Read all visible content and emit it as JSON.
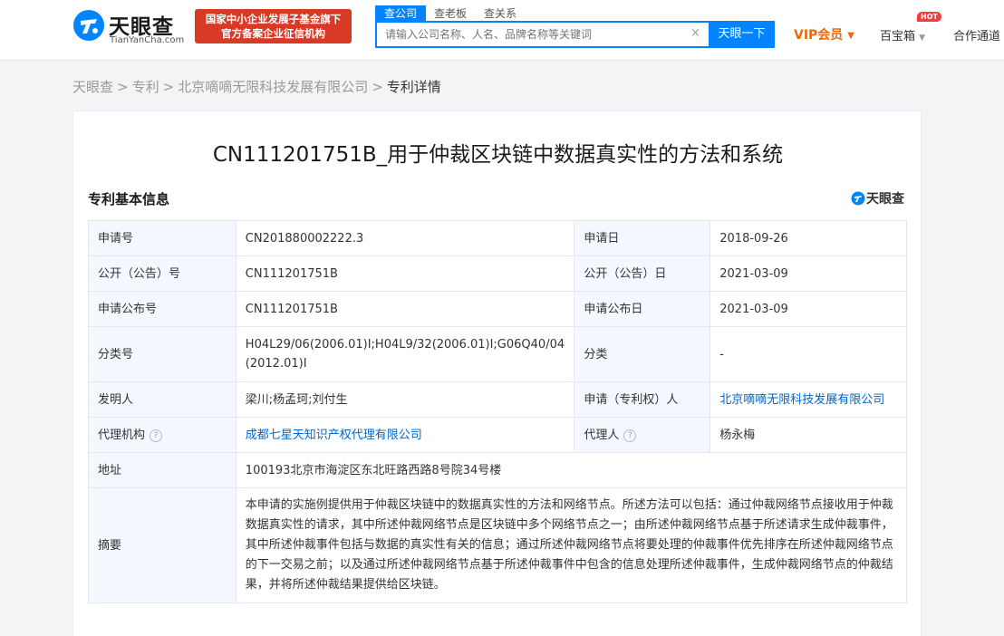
{
  "header": {
    "logo_name": "天眼查",
    "logo_domain": "TianYanCha.com",
    "gov_badge_line1": "国家中小企业发展子基金旗下",
    "gov_badge_line2": "官方备案企业征信机构",
    "search_tabs": [
      "查公司",
      "查老板",
      "查关系"
    ],
    "search_placeholder": "请输入公司名称、人名、品牌名称等关键词",
    "search_clear": "×",
    "search_button": "天眼一下",
    "vip_label": "VIP会员",
    "treasure_label": "百宝箱",
    "hot_badge": "HOT",
    "partner_label": "合作通道"
  },
  "breadcrumb": {
    "items": [
      "天眼查",
      "专利",
      "北京嘀嘀无限科技发展有限公司"
    ],
    "separator": ">",
    "current": "专利详情"
  },
  "patent": {
    "title": "CN111201751B_用于仲裁区块链中数据真实性的方法和系统",
    "section_title": "专利基本信息",
    "watermark": "天眼查",
    "labels": {
      "app_no": "申请号",
      "app_date": "申请日",
      "pub_no": "公开（公告）号",
      "pub_date": "公开（公告）日",
      "app_pub_no": "申请公布号",
      "app_pub_date": "申请公布日",
      "class_no": "分类号",
      "category": "分类",
      "inventor": "发明人",
      "applicant": "申请（专利权）人",
      "agency": "代理机构",
      "agent": "代理人",
      "address": "地址",
      "abstract": "摘要"
    },
    "values": {
      "app_no": "CN201880002222.3",
      "app_date": "2018-09-26",
      "pub_no": "CN111201751B",
      "pub_date": "2021-03-09",
      "app_pub_no": "CN111201751B",
      "app_pub_date": "2021-03-09",
      "class_no": "H04L29/06(2006.01)I;H04L9/32(2006.01)I;G06Q40/04(2012.01)I",
      "category": "-",
      "inventor": "梁川;杨孟珂;刘付生",
      "applicant": "北京嘀嘀无限科技发展有限公司",
      "agency": "成都七星天知识产权代理有限公司",
      "agent": "杨永梅",
      "address": "100193北京市海淀区东北旺路西路8号院34号楼",
      "abstract": "本申请的实施例提供用于仲裁区块链中的数据真实性的方法和网络节点。所述方法可以包括：通过仲裁网络节点接收用于仲裁数据真实性的请求，其中所述仲裁网络节点是区块链中多个网络节点之一；由所述仲裁网络节点基于所述请求生成仲裁事件，其中所述仲裁事件包括与数据的真实性有关的信息；通过所述仲裁网络节点将要处理的仲裁事件优先排序在所述仲裁网络节点的下一交易之前；以及通过所述仲裁网络节点基于所述仲裁事件中包含的信息处理所述仲裁事件，生成仲裁网络节点的仲裁结果，并将所述仲裁结果提供给区块链。"
    },
    "help_icon": "?"
  },
  "colors": {
    "brand_blue": "#0084ff",
    "badge_red": "#d93a26",
    "vip_orange": "#e8690e",
    "link_blue": "#0066cc",
    "label_bg": "#f2f8fe"
  }
}
